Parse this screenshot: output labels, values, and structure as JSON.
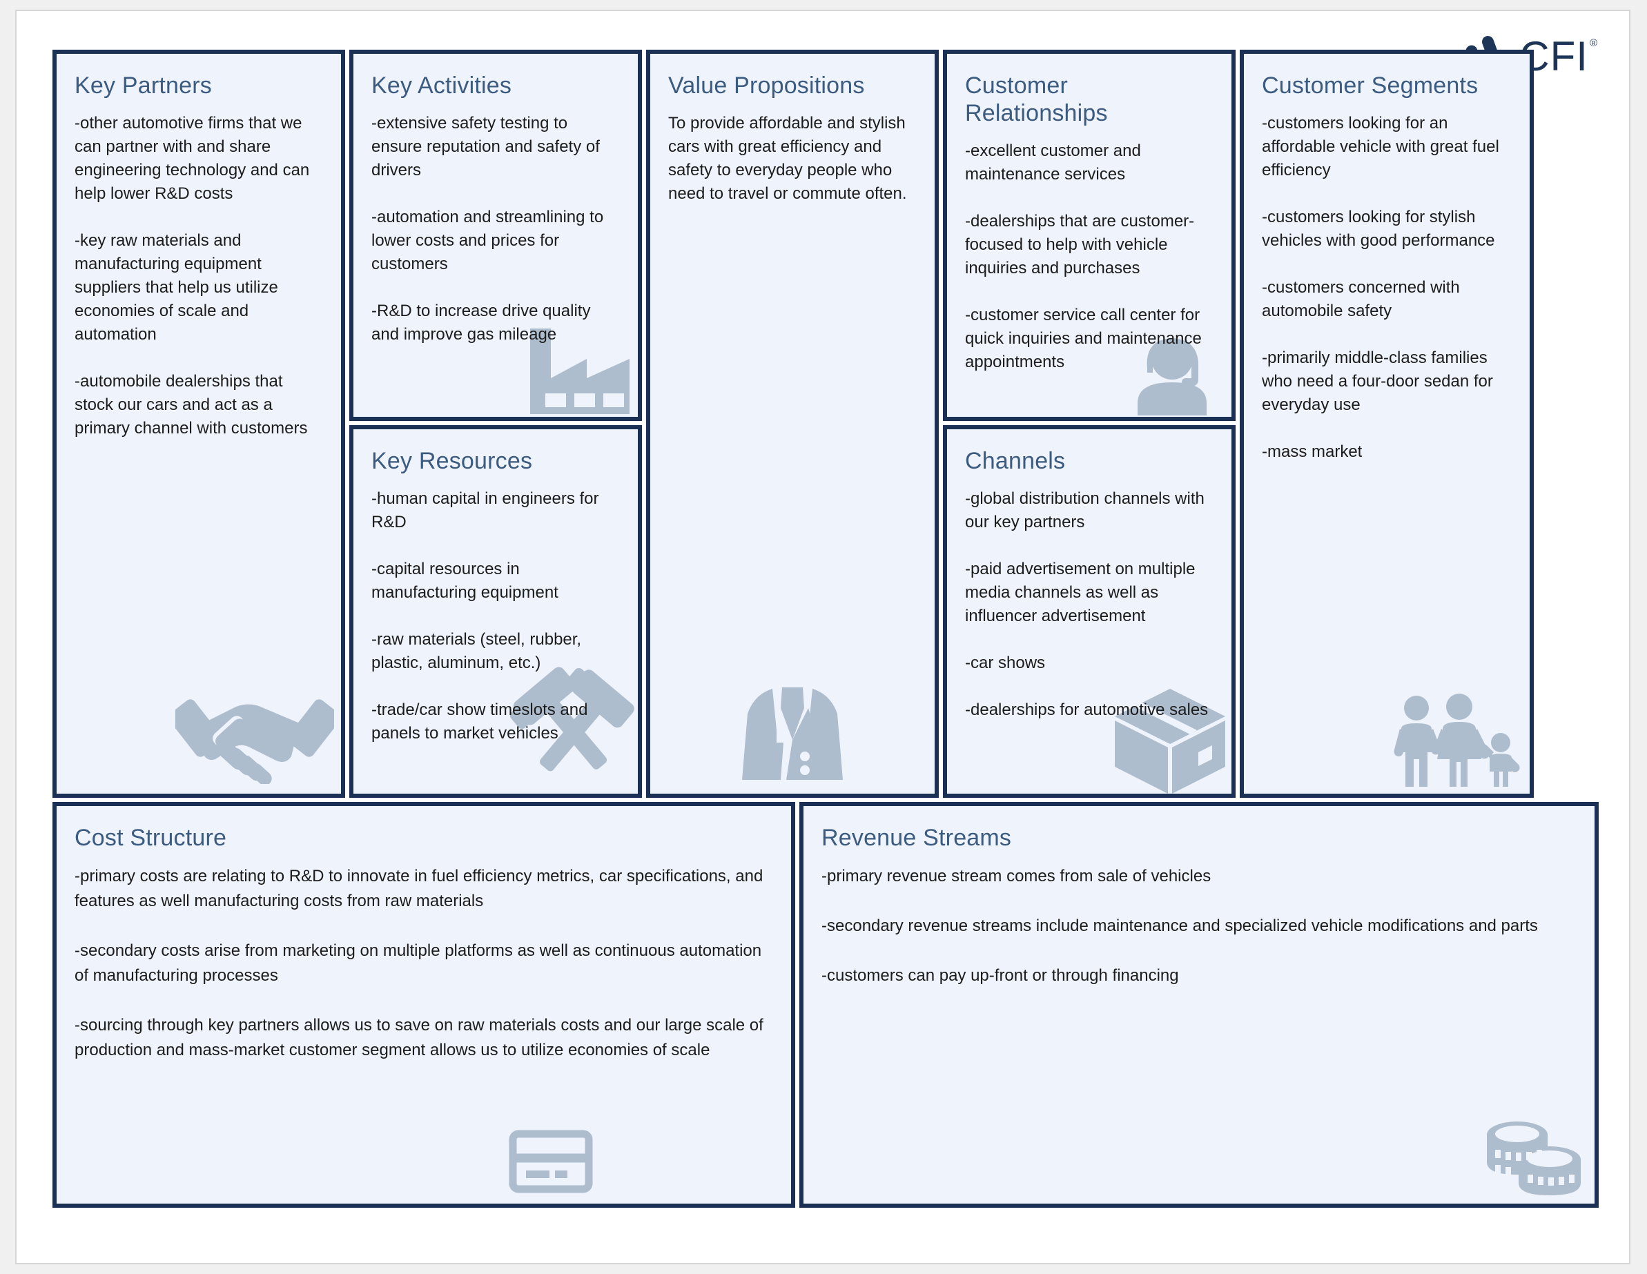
{
  "brand": {
    "logo_word": "CFI",
    "logo_registered": "®",
    "logo_color": "#1d3557"
  },
  "canvas": {
    "border_color": "#1a3054",
    "cell_background": "#eff3fb",
    "heading_color": "#3c5b80",
    "icon_color": "#aebdcd",
    "blocks": [
      {
        "key": "key_partners",
        "title": "Key Partners",
        "icon": "handshake-icon",
        "bullets": [
          "-other automotive firms that we can partner with and share engineering technology and can help lower R&D costs",
          "-key raw materials and manufacturing equipment suppliers that help us utilize economies of scale and automation",
          "-automobile dealerships that stock our cars and act as a primary channel with customers"
        ]
      },
      {
        "key": "key_activities",
        "title": "Key Activities",
        "icon": "factory-icon",
        "bullets": [
          "-extensive safety testing to ensure reputation and safety of drivers",
          "-automation and streamlining to lower costs and prices for customers",
          "-R&D to increase drive quality and improve gas mileage"
        ]
      },
      {
        "key": "key_resources",
        "title": "Key Resources",
        "icon": "hammers-icon",
        "bullets": [
          "-human capital in engineers for R&D",
          "-capital resources in manufacturing equipment",
          "-raw materials (steel, rubber, plastic, aluminum, etc.)",
          "-trade/car show timeslots and panels to market vehicles"
        ]
      },
      {
        "key": "value_propositions",
        "title": "Value Propositions",
        "icon": "suit-jacket-icon",
        "bullets": [
          "To provide affordable and stylish cars with great efficiency and safety to everyday people who need to travel or commute often."
        ]
      },
      {
        "key": "customer_relationships",
        "title": "Customer Relationships",
        "icon": "headset-support-icon",
        "bullets": [
          "-excellent customer and maintenance services",
          "-dealerships that are customer-focused to help with vehicle inquiries and purchases",
          "-customer service call center for quick inquiries and maintenance appointments"
        ]
      },
      {
        "key": "channels",
        "title": "Channels",
        "icon": "box-package-icon",
        "bullets": [
          "-global distribution channels with our key partners",
          "-paid advertisement on multiple media channels as well as influencer advertisement",
          "-car shows",
          "-dealerships for automotive sales"
        ]
      },
      {
        "key": "customer_segments",
        "title": "Customer Segments",
        "icon": "family-icon",
        "bullets": [
          "-customers looking for an affordable vehicle with great fuel efficiency",
          "-customers looking for stylish vehicles with good performance",
          "-customers concerned with automobile safety",
          "-primarily middle-class families who need a four-door sedan for everyday use",
          "-mass market"
        ]
      },
      {
        "key": "cost_structure",
        "title": "Cost Structure",
        "icon": "credit-card-icon",
        "bullets": [
          "-primary costs are relating to R&D to innovate in fuel efficiency metrics, car specifications, and features as well manufacturing costs from raw materials",
          "-secondary costs arise from marketing on multiple platforms as well as continuous automation of manufacturing processes",
          "-sourcing through key partners allows us to save on raw materials costs and our large scale of production and mass-market customer segment allows us to utilize economies of scale"
        ]
      },
      {
        "key": "revenue_streams",
        "title": "Revenue Streams",
        "icon": "coins-icon",
        "bullets": [
          "-primary revenue stream comes from sale of vehicles",
          "-secondary revenue streams include maintenance and specialized vehicle modifications and parts",
          "-customers can pay up-front or through financing"
        ]
      }
    ]
  }
}
